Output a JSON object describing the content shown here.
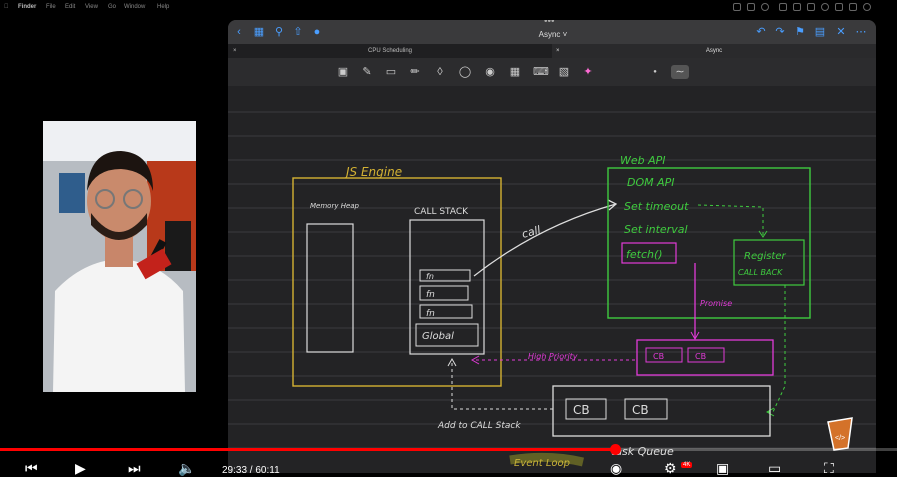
{
  "menubar": {
    "items": [
      "Finder",
      "File",
      "Edit",
      "View",
      "Go",
      "Window",
      "Help"
    ]
  },
  "window": {
    "title": "Async",
    "tabs": [
      "CPU Scheduling",
      "Async"
    ]
  },
  "diagram": {
    "js_engine": "JS Engine",
    "memory_heap": "Memory Heap",
    "call_stack": "CALL STACK",
    "stack_items": [
      "fn",
      "fn",
      "fn",
      "Global"
    ],
    "call": "call",
    "web_api": "Web API",
    "web_api_items": [
      "DOM API",
      "Set timeout",
      "Set interval",
      "fetch()"
    ],
    "register": "Register",
    "call_back": "CALL BACK",
    "promise": "Promise",
    "high_priority": "High Priority",
    "micro_queue": [
      "CB",
      "CB"
    ],
    "task_queue_items": [
      "CB",
      "CB"
    ],
    "task_queue": "task Queue",
    "add_to_call_stack": "Add to CALL Stack",
    "event_loop": "Event Loop"
  },
  "player": {
    "timecode": "29:33 / 60:11",
    "progress": 0.686,
    "colors": {
      "progress": "#ff0000"
    }
  }
}
